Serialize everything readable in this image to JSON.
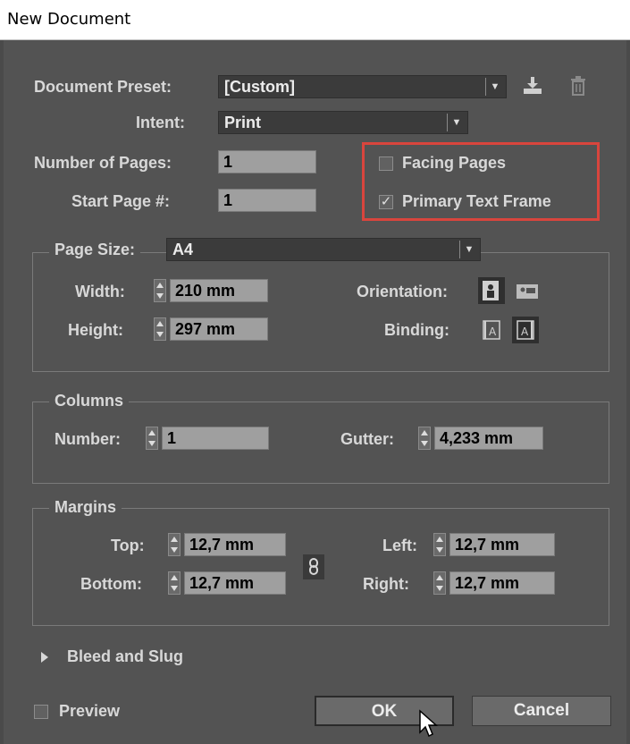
{
  "window": {
    "title": "New Document"
  },
  "preset": {
    "label": "Document Preset:",
    "value": "[Custom]",
    "save_icon": "save-preset-icon",
    "delete_icon": "trash-icon"
  },
  "intent": {
    "label": "Intent:",
    "value": "Print"
  },
  "pages": {
    "number_label": "Number of Pages:",
    "number_value": "1",
    "start_label": "Start Page #:",
    "start_value": "1",
    "facing_label": "Facing Pages",
    "facing_checked": false,
    "primary_label": "Primary Text Frame",
    "primary_checked": true,
    "highlight_color": "#d9453d"
  },
  "page_size": {
    "label": "Page Size:",
    "value": "A4",
    "width_label": "Width:",
    "width_value": "210 mm",
    "height_label": "Height:",
    "height_value": "297 mm",
    "orientation_label": "Orientation:",
    "orientation_selected": "portrait",
    "binding_label": "Binding:",
    "binding_selected": "right-to-left"
  },
  "columns": {
    "legend": "Columns",
    "number_label": "Number:",
    "number_value": "1",
    "gutter_label": "Gutter:",
    "gutter_value": "4,233 mm"
  },
  "margins": {
    "legend": "Margins",
    "top_label": "Top:",
    "top_value": "12,7 mm",
    "bottom_label": "Bottom:",
    "bottom_value": "12,7 mm",
    "left_label": "Left:",
    "left_value": "12,7 mm",
    "right_label": "Right:",
    "right_value": "12,7 mm",
    "link_icon": "chain-link-icon"
  },
  "bleed": {
    "label": "Bleed and Slug"
  },
  "footer": {
    "preview_label": "Preview",
    "ok_label": "OK",
    "cancel_label": "Cancel"
  }
}
